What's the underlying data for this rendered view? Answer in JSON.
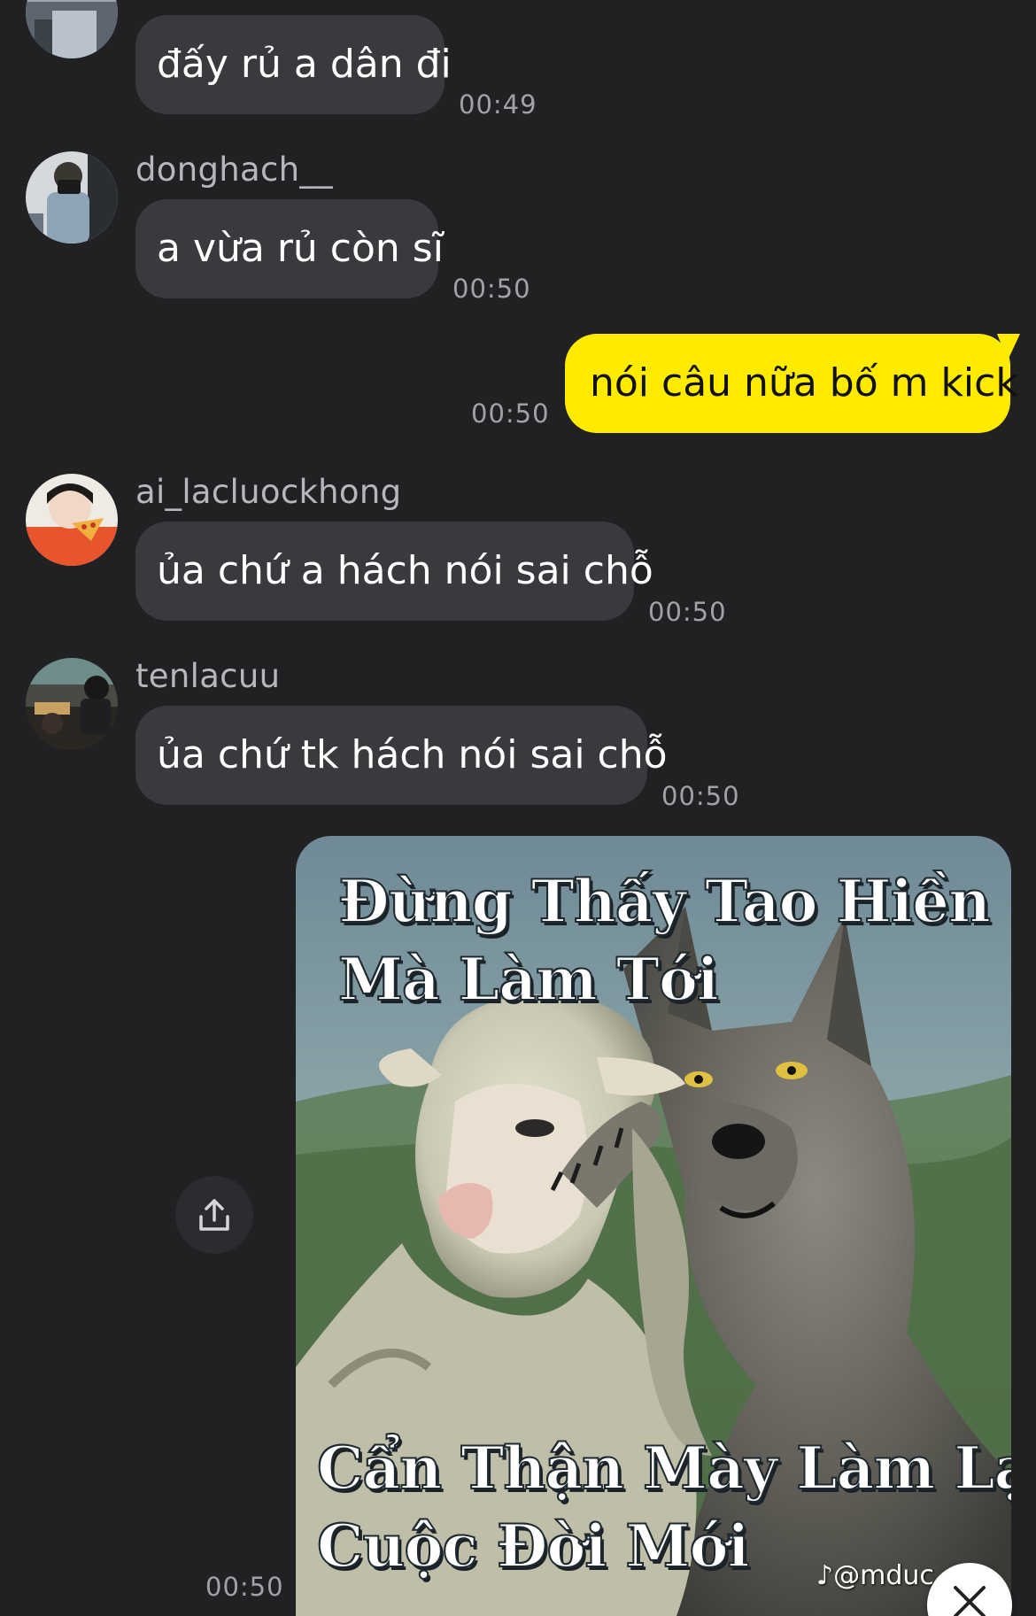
{
  "messages": [
    {
      "type": "incoming",
      "text": "đấy rủ a dân đi",
      "time": "00:49"
    },
    {
      "type": "incoming",
      "sender": "donghach__",
      "text": "a vừa rủ còn sĩ",
      "time": "00:50"
    },
    {
      "type": "outgoing",
      "text": "nói câu nữa bố m kick",
      "time": "00:50"
    },
    {
      "type": "incoming",
      "sender": "ai_lacluockhong",
      "text": "ủa chứ a hách nói sai chỗ",
      "time": "00:50"
    },
    {
      "type": "incoming",
      "sender": "tenlacuu",
      "text": "ủa chứ tk hách nói sai chỗ",
      "time": "00:50"
    },
    {
      "type": "outgoing-image",
      "time": "00:50",
      "top_caption": [
        "Đừng Thấy Tao Hiền",
        "Mà Làm Tới"
      ],
      "bottom_caption": [
        "Cẩn Thận Mày Làm Lại",
        "Cuộc Đời Mới"
      ],
      "watermark": "@mduc_win"
    }
  ],
  "icons": {
    "share": "share-icon",
    "close": "close-icon"
  },
  "colors": {
    "background": "#212124",
    "incoming_bubble": "#3a3a3e",
    "outgoing_bubble": "#ffeb00"
  }
}
